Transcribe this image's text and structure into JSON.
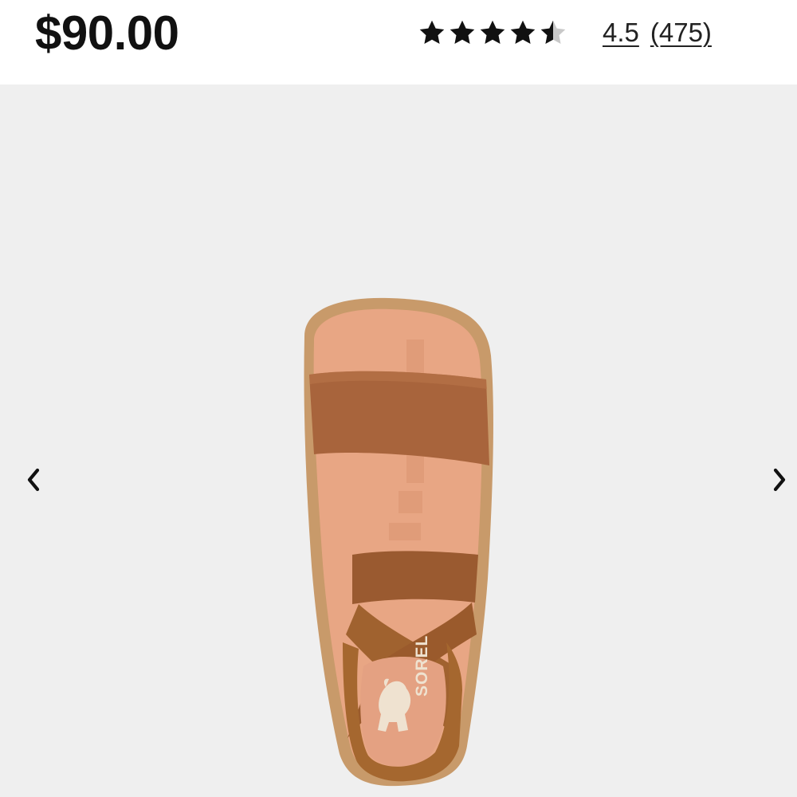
{
  "product": {
    "price": "$90.00",
    "rating": {
      "value": "4.5",
      "count": "(475)",
      "stars_filled": 4.5,
      "stars_total": 5
    },
    "image_logo_text": "SOREL"
  },
  "gallery": {
    "prev_icon": "chevron-left-icon",
    "next_icon": "chevron-right-icon"
  },
  "colors": {
    "star": "#111111",
    "star_empty": "#c8c8c8",
    "gallery_bg": "#efefef",
    "text": "#111111"
  }
}
